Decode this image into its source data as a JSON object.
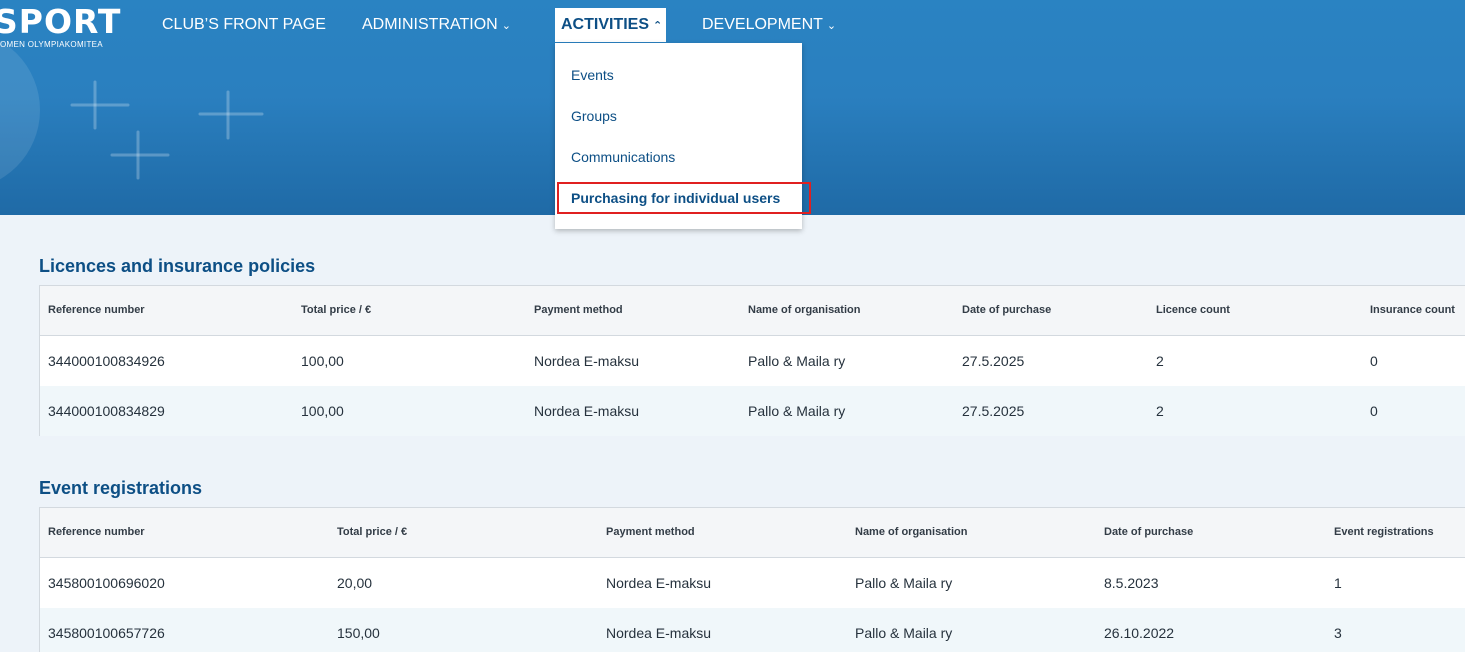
{
  "logo": {
    "main": "SPORT",
    "sub": "OMEN OLYMPIAKOMITEA"
  },
  "nav": [
    {
      "label": "CLUB’S FRONT PAGE",
      "chevron": ""
    },
    {
      "label": "ADMINISTRATION",
      "chevron": "⌄"
    },
    {
      "label": "ACTIVITIES",
      "chevron": "⌃"
    },
    {
      "label": "DEVELOPMENT",
      "chevron": "⌄"
    }
  ],
  "dropdown": {
    "items": [
      "Events",
      "Groups",
      "Communications",
      "Purchasing for individual users"
    ]
  },
  "licences": {
    "title": "Licences and insurance policies",
    "headers": [
      "Reference number",
      "Total price / €",
      "Payment method",
      "Name of organisation",
      "Date of purchase",
      "Licence count",
      "Insurance count"
    ],
    "rows": [
      [
        "344000100834926",
        "100,00",
        "Nordea E-maksu",
        "Pallo & Maila ry",
        "27.5.2025",
        "2",
        "0"
      ],
      [
        "344000100834829",
        "100,00",
        "Nordea E-maksu",
        "Pallo & Maila ry",
        "27.5.2025",
        "2",
        "0"
      ]
    ]
  },
  "events": {
    "title": "Event registrations",
    "headers": [
      "Reference number",
      "Total price / €",
      "Payment method",
      "Name of organisation",
      "Date of purchase",
      "Event registrations"
    ],
    "rows": [
      [
        "345800100696020",
        "20,00",
        "Nordea E-maksu",
        "Pallo & Maila ry",
        "8.5.2023",
        "1"
      ],
      [
        "345800100657726",
        "150,00",
        "Nordea E-maksu",
        "Pallo & Maila ry",
        "26.10.2022",
        "3"
      ]
    ]
  },
  "colors": {
    "header_blue": "#2a83c2",
    "title_blue": "#0d4f85",
    "highlight_red": "#e02020"
  }
}
